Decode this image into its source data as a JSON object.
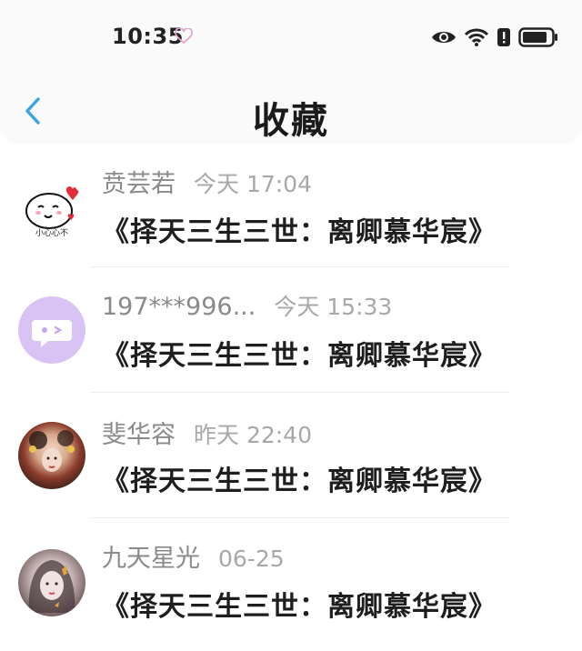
{
  "status_bar": {
    "time": "10:35",
    "heart_icon": "heart-icon",
    "icons": [
      "eye-icon",
      "wifi-icon",
      "alert-icon",
      "battery-icon"
    ]
  },
  "header": {
    "back_icon": "chevron-left-icon",
    "title": "收藏"
  },
  "colors": {
    "accent": "#3aa2e6",
    "username": "#8a8a8a",
    "timestamp": "#a8a8a8",
    "content": "#1e1e1e"
  },
  "items": [
    {
      "user": "贲芸若",
      "time": "今天 17:04",
      "content": "《择天三生三世：离卿慕华宸》",
      "avatar": "emoji-face-avatar",
      "avatar_text": "小心心不"
    },
    {
      "user": "197***996...",
      "time": "今天 15:33",
      "content": "《择天三生三世：离卿慕华宸》",
      "avatar": "chat-bubble-avatar"
    },
    {
      "user": "斐华容",
      "time": "昨天 22:40",
      "content": "《择天三生三世：离卿慕华宸》",
      "avatar": "photo-avatar"
    },
    {
      "user": "九天星光",
      "time": "06-25",
      "content": "《择天三生三世：离卿慕华宸》",
      "avatar": "photo-avatar"
    }
  ]
}
